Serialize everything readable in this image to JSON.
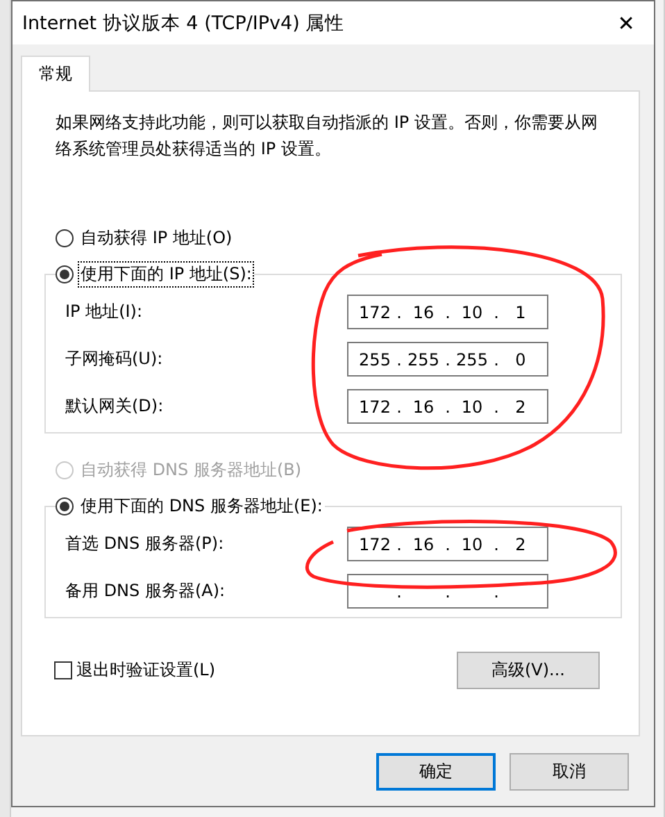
{
  "window": {
    "title": "Internet 协议版本 4 (TCP/IPv4) 属性",
    "close": "✕"
  },
  "tabs": [
    {
      "label": "常规",
      "selected": true
    }
  ],
  "description": "如果网络支持此功能，则可以获取自动指派的 IP 设置。否则，你需要从网络系统管理员处获得适当的 IP 设置。",
  "octet_separator": ".",
  "ip_section": {
    "options": [
      {
        "label": "自动获得 IP 地址(O)",
        "selected": false,
        "disabled": false
      },
      {
        "label": "使用下面的 IP 地址(S):",
        "selected": true,
        "disabled": false
      }
    ],
    "fields": [
      {
        "label": "IP 地址(I):",
        "octets": [
          "172",
          "16",
          "10",
          "1"
        ]
      },
      {
        "label": "子网掩码(U):",
        "octets": [
          "255",
          "255",
          "255",
          "0"
        ]
      },
      {
        "label": "默认网关(D):",
        "octets": [
          "172",
          "16",
          "10",
          "2"
        ]
      }
    ]
  },
  "dns_section": {
    "options": [
      {
        "label": "自动获得 DNS 服务器地址(B)",
        "selected": false,
        "disabled": true
      },
      {
        "label": "使用下面的 DNS 服务器地址(E):",
        "selected": true,
        "disabled": false
      }
    ],
    "fields": [
      {
        "label": "首选 DNS 服务器(P):",
        "octets": [
          "172",
          "16",
          "10",
          "2"
        ]
      },
      {
        "label": "备用 DNS 服务器(A):"
      }
    ]
  },
  "validate_checkbox": {
    "label": "退出时验证设置(L)",
    "checked": false
  },
  "advanced_button": "高级(V)...",
  "buttons": [
    {
      "label": "确定",
      "default": true
    },
    {
      "label": "取消",
      "default": false
    }
  ]
}
